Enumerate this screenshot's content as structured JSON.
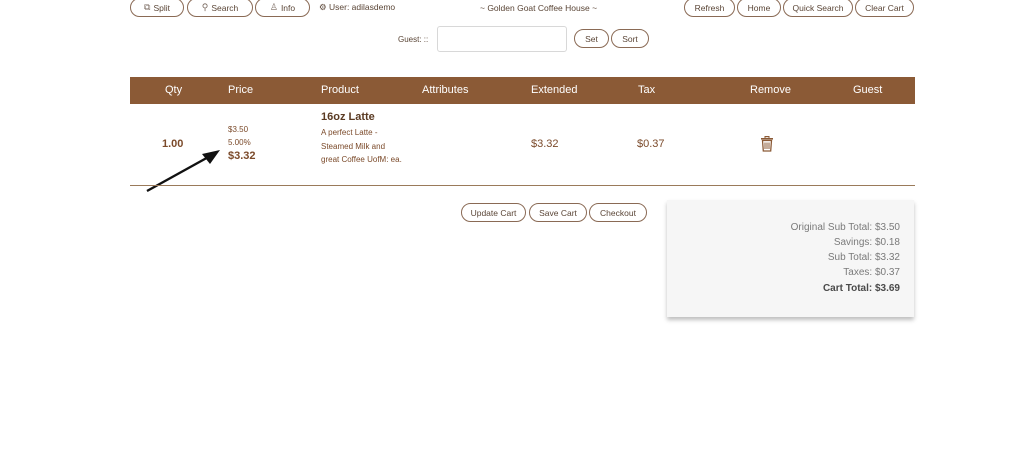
{
  "toolbar": {
    "split": "Split",
    "search": "Search",
    "info": "Info",
    "user": "User: adilasdemo",
    "store": "~ Golden Goat Coffee House ~",
    "refresh": "Refresh",
    "home": "Home",
    "quick_search": "Quick Search",
    "clear_cart": "Clear Cart"
  },
  "guest": {
    "label": "Guest: ::",
    "value": "",
    "set": "Set",
    "sort": "Sort"
  },
  "table": {
    "headers": [
      "Qty",
      "Price",
      "Product",
      "Attributes",
      "Extended",
      "Tax",
      "Remove",
      "Guest"
    ],
    "row": {
      "qty": "1.00",
      "price_original": "$3.50",
      "discount": "5.00%",
      "price_final": "$3.32",
      "product_name": "16oz Latte",
      "product_desc": "A perfect Latte - Steamed Milk and great Coffee UofM: ea.",
      "extended": "$3.32",
      "tax": "$0.37"
    }
  },
  "actions": {
    "update_cart": "Update Cart",
    "save_cart": "Save Cart",
    "checkout": "Checkout"
  },
  "summary": {
    "original": "Original Sub Total: $3.50",
    "savings": "Savings: $0.18",
    "subtotal": "Sub Total: $3.32",
    "taxes": "Taxes: $0.37",
    "total": "Cart Total: $3.69"
  },
  "colors": {
    "header": "#8b5a36",
    "accent_text": "#7b4a2a"
  },
  "icons": [
    "split-icon",
    "search-icon",
    "user-plus-icon",
    "gear-icon",
    "trash-icon",
    "arrow-annotation"
  ]
}
